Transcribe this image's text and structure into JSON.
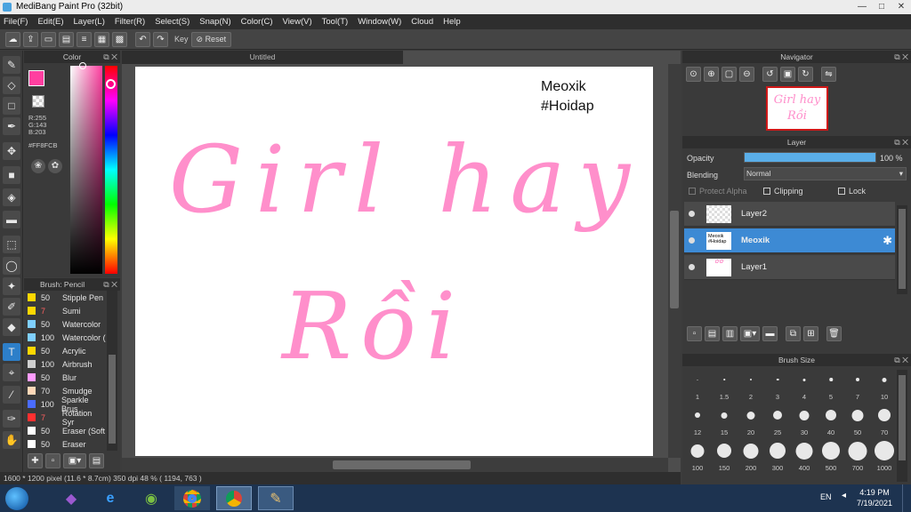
{
  "window": {
    "title": "MediBang Paint Pro (32bit)",
    "controls": [
      "—",
      "□",
      "✕"
    ]
  },
  "menu": [
    "File(F)",
    "Edit(E)",
    "Layer(L)",
    "Filter(R)",
    "Select(S)",
    "Snap(N)",
    "Color(C)",
    "View(V)",
    "Tool(T)",
    "Window(W)",
    "Cloud",
    "Help"
  ],
  "toolbar": {
    "key_label": "Key",
    "reset_label": "Reset"
  },
  "color_panel": {
    "title": "Color",
    "rgb_r": "R:255",
    "rgb_g": "G:143",
    "rgb_b": "B:203",
    "hex": "#FF8FCB",
    "primary_color": "#FF8FCB"
  },
  "brush_panel": {
    "title": "Brush: Pencil",
    "brushes": [
      {
        "size": "50",
        "name": "Stipple Pen",
        "color": "#ffd800"
      },
      {
        "size": "7",
        "name": "Sumi",
        "color": "#ffd800"
      },
      {
        "size": "50",
        "name": "Watercolor",
        "color": "#7fd0ff"
      },
      {
        "size": "100",
        "name": "Watercolor (",
        "color": "#7fd0ff"
      },
      {
        "size": "50",
        "name": "Acrylic",
        "color": "#ffd800"
      },
      {
        "size": "100",
        "name": "Airbrush",
        "color": "#d0d0d0"
      },
      {
        "size": "50",
        "name": "Blur",
        "color": "#ff9cff"
      },
      {
        "size": "70",
        "name": "Smudge",
        "color": "#ffd8b8"
      },
      {
        "size": "100",
        "name": "Sparkle Brus",
        "color": "#4a6cff"
      },
      {
        "size": "7",
        "name": "Rotation Syr",
        "color": "#ff3030"
      },
      {
        "size": "50",
        "name": "Eraser (Soft",
        "color": "#ffffff"
      },
      {
        "size": "50",
        "name": "Eraser",
        "color": "#ffffff"
      }
    ]
  },
  "document": {
    "tab_title": "Untitled",
    "text_line1": "Meoxik",
    "text_line2": "#Hoidap",
    "lettering_line1": "Girl hay",
    "lettering_line2": "Rồi",
    "lettering_color": "#ff8fcb"
  },
  "status": "1600 * 1200 pixel   (11.6 * 8.7cm)   350 dpi   48 %   ( 1194, 763 )",
  "navigator": {
    "title": "Navigator",
    "thumb_line1": "Girl hay",
    "thumb_line2": "Rồi"
  },
  "layer_panel": {
    "title": "Layer",
    "opacity_label": "Opacity",
    "opacity_value": "100 %",
    "opacity_fraction": 1.0,
    "blending_label": "Blending",
    "blending_value": "Normal",
    "protect_alpha": "Protect Alpha",
    "clipping": "Clipping",
    "lock": "Lock",
    "layers": [
      {
        "name": "Layer2",
        "selected": false
      },
      {
        "name": "Meoxik",
        "selected": true,
        "thumb_text": "Meoxik #Hoidap"
      },
      {
        "name": "Layer1",
        "selected": false
      }
    ]
  },
  "brush_size_panel": {
    "title": "Brush Size",
    "sizes": [
      "1",
      "1.5",
      "2",
      "3",
      "4",
      "5",
      "7",
      "10",
      "12",
      "15",
      "20",
      "25",
      "30",
      "40",
      "50",
      "70",
      "100",
      "150",
      "200",
      "300",
      "400",
      "500",
      "700",
      "1000"
    ]
  },
  "taskbar": {
    "language": "EN",
    "time": "4:19 PM",
    "date": "7/19/2021"
  }
}
